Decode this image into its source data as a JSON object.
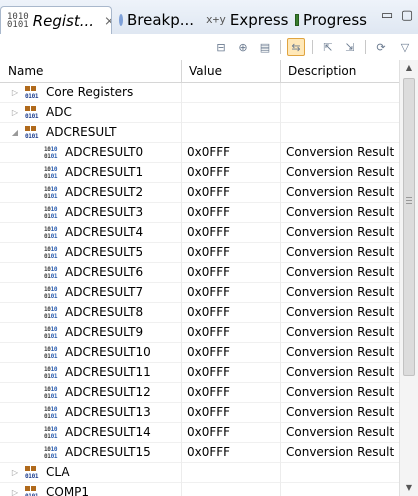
{
  "tabs": [
    {
      "label": "Regist...",
      "icon": "registers-icon",
      "close": "⨯",
      "active": true
    },
    {
      "label": "Breakp...",
      "icon": "breakpoints-icon"
    },
    {
      "label": "Express...",
      "icon": "expressions-icon"
    },
    {
      "label": "Progress",
      "icon": "progress-icon"
    }
  ],
  "window_controls": {
    "minimize": "▭",
    "maximize": "▢"
  },
  "toolbar": [
    "collapse-all-icon",
    "new-group-icon",
    "toggle-view-icon",
    "link-highlight-icon",
    "export-icon",
    "import-icon",
    "refresh-icon",
    "view-menu-icon"
  ],
  "columns": {
    "name": "Name",
    "value": "Value",
    "description": "Description"
  },
  "rows": [
    {
      "level": 0,
      "type": "group",
      "expanded": false,
      "name": "Core Registers",
      "value": "",
      "description": ""
    },
    {
      "level": 0,
      "type": "group",
      "expanded": false,
      "name": "ADC",
      "value": "",
      "description": ""
    },
    {
      "level": 0,
      "type": "group",
      "expanded": true,
      "name": "ADCRESULT",
      "value": "",
      "description": ""
    },
    {
      "level": 1,
      "type": "register",
      "name": "ADCRESULT0",
      "value": "0x0FFF",
      "description": "Conversion Result B"
    },
    {
      "level": 1,
      "type": "register",
      "name": "ADCRESULT1",
      "value": "0x0FFF",
      "description": "Conversion Result B"
    },
    {
      "level": 1,
      "type": "register",
      "name": "ADCRESULT2",
      "value": "0x0FFF",
      "description": "Conversion Result B"
    },
    {
      "level": 1,
      "type": "register",
      "name": "ADCRESULT3",
      "value": "0x0FFF",
      "description": "Conversion Result B"
    },
    {
      "level": 1,
      "type": "register",
      "name": "ADCRESULT4",
      "value": "0x0FFF",
      "description": "Conversion Result B"
    },
    {
      "level": 1,
      "type": "register",
      "name": "ADCRESULT5",
      "value": "0x0FFF",
      "description": "Conversion Result B"
    },
    {
      "level": 1,
      "type": "register",
      "name": "ADCRESULT6",
      "value": "0x0FFF",
      "description": "Conversion Result B"
    },
    {
      "level": 1,
      "type": "register",
      "name": "ADCRESULT7",
      "value": "0x0FFF",
      "description": "Conversion Result B"
    },
    {
      "level": 1,
      "type": "register",
      "name": "ADCRESULT8",
      "value": "0x0FFF",
      "description": "Conversion Result B"
    },
    {
      "level": 1,
      "type": "register",
      "name": "ADCRESULT9",
      "value": "0x0FFF",
      "description": "Conversion Result B"
    },
    {
      "level": 1,
      "type": "register",
      "name": "ADCRESULT10",
      "value": "0x0FFF",
      "description": "Conversion Result B"
    },
    {
      "level": 1,
      "type": "register",
      "name": "ADCRESULT11",
      "value": "0x0FFF",
      "description": "Conversion Result B"
    },
    {
      "level": 1,
      "type": "register",
      "name": "ADCRESULT12",
      "value": "0x0FFF",
      "description": "Conversion Result B"
    },
    {
      "level": 1,
      "type": "register",
      "name": "ADCRESULT13",
      "value": "0x0FFF",
      "description": "Conversion Result B"
    },
    {
      "level": 1,
      "type": "register",
      "name": "ADCRESULT14",
      "value": "0x0FFF",
      "description": "Conversion Result B"
    },
    {
      "level": 1,
      "type": "register",
      "name": "ADCRESULT15",
      "value": "0x0FFF",
      "description": "Conversion Result B"
    },
    {
      "level": 0,
      "type": "group",
      "expanded": false,
      "name": "CLA",
      "value": "",
      "description": ""
    },
    {
      "level": 0,
      "type": "group",
      "expanded": false,
      "name": "COMP1",
      "value": "",
      "description": ""
    }
  ],
  "scrollbar": {
    "up": "▲",
    "down": "▼"
  }
}
